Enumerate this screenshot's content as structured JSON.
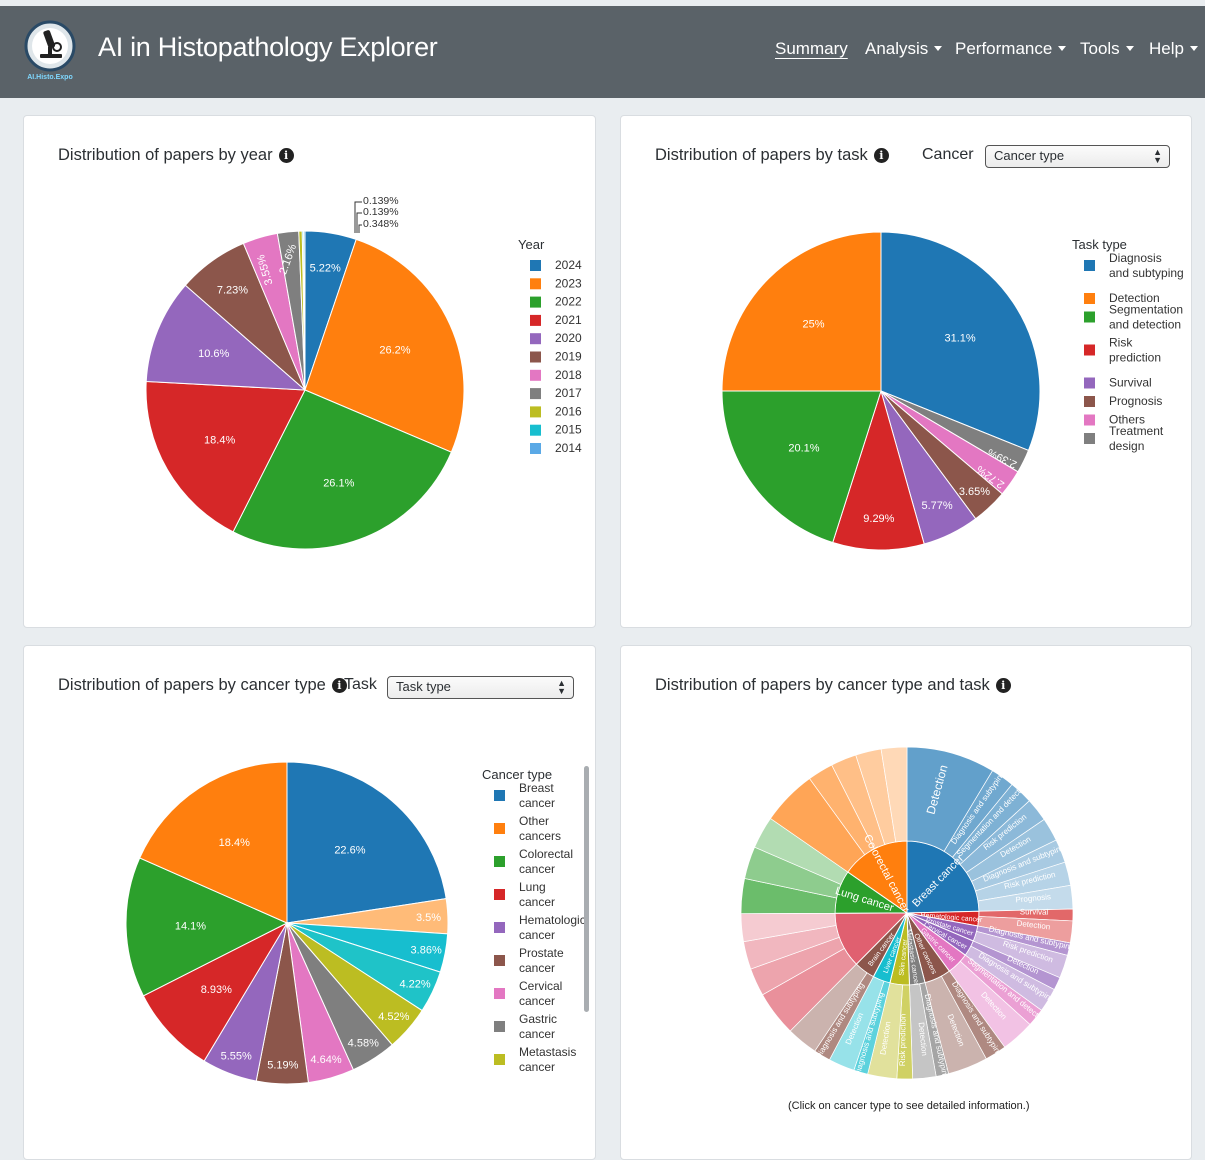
{
  "app": {
    "title": "AI in Histopathology Explorer",
    "logo_caption": "AI.Histo.Expo"
  },
  "nav": [
    {
      "label": "Summary",
      "active": true,
      "dropdown": false
    },
    {
      "label": "Analysis",
      "active": false,
      "dropdown": true
    },
    {
      "label": "Performance",
      "active": false,
      "dropdown": true
    },
    {
      "label": "Tools",
      "active": false,
      "dropdown": true
    },
    {
      "label": "Help",
      "active": false,
      "dropdown": true
    }
  ],
  "colors": {
    "palette": [
      "#1f77b4",
      "#ff7f0e",
      "#2ca02c",
      "#d62728",
      "#9467bd",
      "#8c564b",
      "#e377c2",
      "#7f7f7f",
      "#bcbd22",
      "#17becf",
      "#5aa9e6"
    ],
    "navbar": "#5a6268"
  },
  "cards": {
    "year": {
      "title": "Distribution of papers by year"
    },
    "task": {
      "title": "Distribution of papers by task",
      "filter_label": "Cancer",
      "select_value": "Cancer type"
    },
    "cancer": {
      "title": "Distribution of papers by cancer type",
      "filter_label": "Task",
      "select_value": "Task type"
    },
    "sunburst": {
      "title": "Distribution of papers by cancer type and task",
      "footnote": "(Click on cancer type to see detailed information.)"
    }
  },
  "chart_data": [
    {
      "type": "pie",
      "legend_title": "Year",
      "labels": [
        "2024",
        "2023",
        "2022",
        "2021",
        "2020",
        "2019",
        "2018",
        "2017",
        "2016",
        "2015",
        "2014"
      ],
      "values": [
        5.22,
        26.2,
        26.1,
        18.4,
        10.6,
        7.23,
        3.55,
        2.16,
        0.348,
        0.139,
        0.139
      ],
      "value_labels": [
        "5.22%",
        "26.2%",
        "26.1%",
        "18.4%",
        "10.6%",
        "7.23%",
        "3.55%",
        "2.16%",
        "0.348%",
        "0.139%",
        "0.139%"
      ]
    },
    {
      "type": "pie",
      "legend_title": "Task type",
      "labels": [
        "Diagnosis and subtyping",
        "Detection",
        "Segmentation and detection",
        "Risk prediction",
        "Survival",
        "Prognosis",
        "Others",
        "Treatment design"
      ],
      "values": [
        31.1,
        25,
        20.1,
        9.29,
        5.77,
        3.65,
        2.72,
        2.39
      ],
      "value_labels": [
        "31.1%",
        "25%",
        "20.1%",
        "9.29%",
        "5.77%",
        "3.65%",
        "2.72%",
        "2.39%"
      ]
    },
    {
      "type": "pie",
      "legend_title": "Cancer type",
      "labels": [
        "Breast cancer",
        "Other cancers",
        "Colorectal cancer",
        "Lung cancer",
        "Hematologic cancer",
        "Prostate cancer",
        "Cervical cancer",
        "Gastric cancer",
        "Metastasis cancer"
      ],
      "values": [
        22.6,
        3.5,
        3.86,
        4.22,
        4.52,
        4.58,
        4.64,
        5.19,
        5.55,
        8.93,
        14.1,
        18.4
      ],
      "value_labels": [
        "22.6%",
        "3.5%",
        "3.86%",
        "4.22%",
        "4.52%",
        "4.58%",
        "4.64%",
        "5.19%",
        "5.55%",
        "8.93%",
        "14.1%",
        "18.4%"
      ],
      "slice_colors": [
        "#1f77b4",
        "#ffbb78",
        "#17becf",
        "#1fc3c8",
        "#bcbd22",
        "#7f7f7f",
        "#e377c2",
        "#8c564b",
        "#9467bd",
        "#d62728",
        "#2ca02c",
        "#ff7f0e"
      ]
    },
    {
      "type": "sunburst",
      "inner": [
        {
          "label": "Breast cancer",
          "value": 22.6,
          "color": "#1f77b4"
        },
        {
          "label": "Hematologic cancer",
          "value": 3.0,
          "color": "#d62728"
        },
        {
          "label": "Prostate cancer",
          "value": 3.2,
          "color": "#9467bd"
        },
        {
          "label": "Cervical cancer",
          "value": 3.3,
          "color": "#9467bd"
        },
        {
          "label": "Gastric cancer",
          "value": 4.6,
          "color": "#e377c2"
        },
        {
          "label": "Other cancers",
          "value": 5.5,
          "color": "#8c564b"
        },
        {
          "label": "Metastasis cancer",
          "value": 3.2,
          "color": "#7f7f7f"
        },
        {
          "label": "Skin cancer",
          "value": 4.0,
          "color": "#bcbd22"
        },
        {
          "label": "Liver cancer",
          "value": 3.6,
          "color": "#17becf"
        },
        {
          "label": "Brain cancer",
          "value": 4.3,
          "color": "#8c564b"
        },
        {
          "label": "",
          "value": 11.5,
          "color": "#e06070"
        },
        {
          "label": "Lung cancer",
          "value": 8.9,
          "color": "#2ca02c"
        },
        {
          "label": "Colorectal cancer",
          "value": 14.1,
          "color": "#ff7f0e"
        }
      ],
      "outer_labels": [
        "Detection",
        "Diagnosis and subtyping",
        "Segmentation and detection",
        "Risk prediction",
        "Detection",
        "Diagnosis and subtyping",
        "Risk prediction",
        "Prognosis",
        "Survival",
        "Detection",
        "Diagnosis and subtyping",
        "Risk prediction",
        "Detection",
        "Diagnosis and subtyping",
        "Segmentation and detection",
        "Detection",
        "Diagnosis and subtyping",
        "Detection",
        "Diagnosis and subtyping",
        "Detection",
        "Risk prediction",
        "Detection",
        "Diagnosis and subtyping",
        "Detection",
        "Diagnosis and subtyping"
      ]
    }
  ]
}
